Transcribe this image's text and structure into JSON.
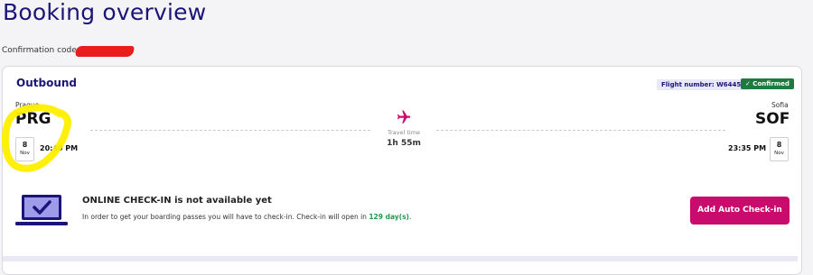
{
  "page": {
    "title": "Booking overview",
    "confirmation_label": "Confirmation code:"
  },
  "outbound": {
    "section_title": "Outbound",
    "flight_number": "Flight number: W64450",
    "status": "✓ Confirmed",
    "travel_time_label": "Travel time",
    "travel_time": "1h 55m",
    "departure": {
      "city": "Prague",
      "code": "PRG",
      "day": "8",
      "month": "Nov",
      "time": "20:40 PM"
    },
    "arrival": {
      "city": "Sofia",
      "code": "SOF",
      "day": "8",
      "month": "Nov",
      "time": "23:35 PM"
    }
  },
  "checkin": {
    "title": "ONLINE CHECK-IN is not available yet",
    "text_before": "In order to get your boarding passes you will have to check-in. Check-in will open in ",
    "days": "129 day(s)",
    "text_after": ".",
    "button_label": "Add Auto Check-in"
  },
  "colors": {
    "accent": "#1b1577",
    "primary_button": "#c90b6e",
    "confirmed": "#1f7a3f",
    "highlight": "#ffee00",
    "redaction": "#e81d1d"
  },
  "icons": [
    "plane-icon",
    "laptop-check-icon",
    "checkmark-icon"
  ]
}
